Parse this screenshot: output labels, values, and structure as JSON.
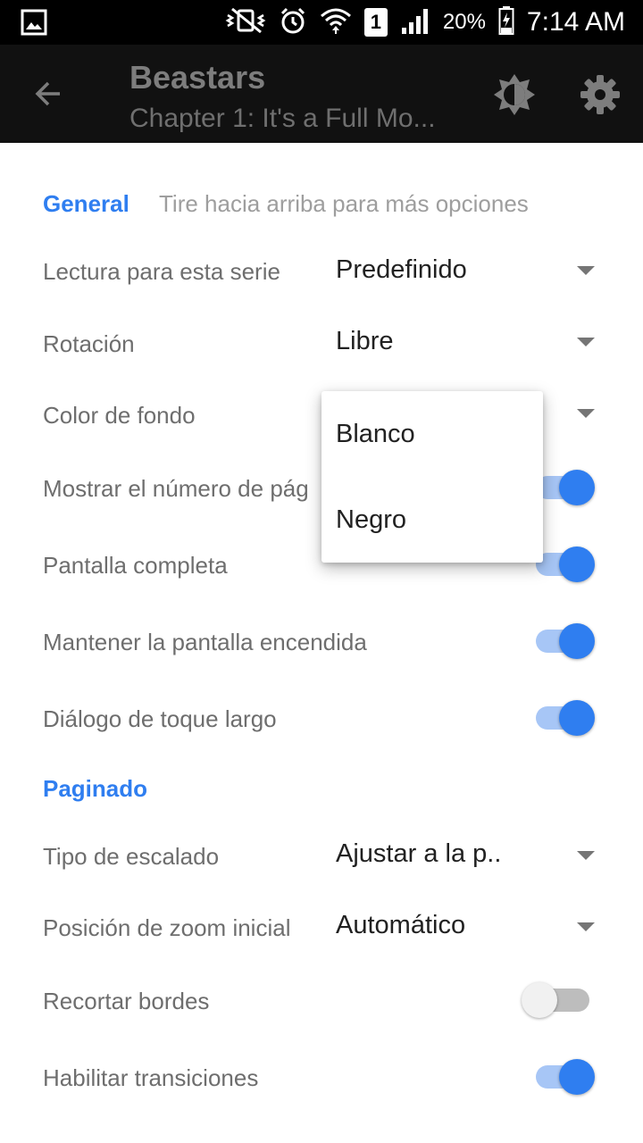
{
  "status_bar": {
    "gallery_icon": "image-icon",
    "icons": [
      "vibrate-mute-icon",
      "alarm-icon",
      "wifi-icon",
      "sim-1-icon",
      "signal-icon"
    ],
    "sim_number": "1",
    "battery_percent": "20%",
    "battery_icon": "battery-charging-icon",
    "time": "7:14 AM"
  },
  "toolbar": {
    "title": "Beastars",
    "subtitle": "Chapter 1: It's a Full Mo...",
    "back_icon": "arrow-back-icon",
    "brightness_icon": "brightness-icon",
    "settings_icon": "gear-icon"
  },
  "general": {
    "title": "General",
    "hint": "Tire hacia arriba para más opciones",
    "reading_mode": {
      "label": "Lectura para esta serie",
      "value": "Predefinido"
    },
    "rotation": {
      "label": "Rotación",
      "value": "Libre"
    },
    "background_color": {
      "label": "Color de fondo"
    },
    "show_page_number": {
      "label": "Mostrar el número de pág",
      "enabled": true
    },
    "fullscreen": {
      "label": "Pantalla completa",
      "enabled": true
    },
    "keep_screen_on": {
      "label": "Mantener la pantalla encendida",
      "enabled": true
    },
    "long_tap_dialog": {
      "label": "Diálogo de toque largo",
      "enabled": true
    }
  },
  "paged": {
    "title": "Paginado",
    "scale_type": {
      "label": "Tipo de escalado",
      "value": "Ajustar a la p.."
    },
    "zoom_start": {
      "label": "Posición de zoom inicial",
      "value": "Automático"
    },
    "crop_borders": {
      "label": "Recortar bordes",
      "enabled": false
    },
    "transitions": {
      "label": "Habilitar transiciones",
      "enabled": true
    }
  },
  "dropdown": {
    "options": [
      "Blanco",
      "Negro"
    ]
  },
  "colors": {
    "accent": "#2f7ef0",
    "toolbar_bg": "#111111",
    "status_bg": "#000000"
  }
}
